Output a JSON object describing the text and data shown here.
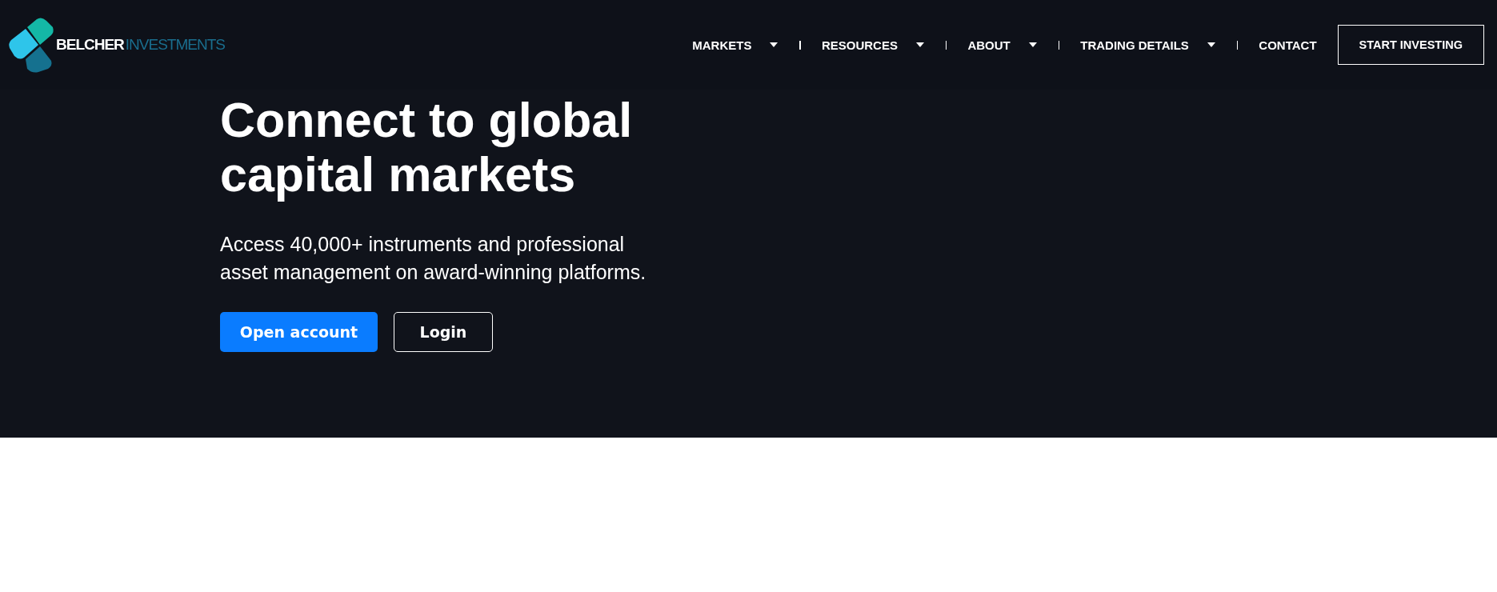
{
  "logo": {
    "name": "BELCHER",
    "suffix": "INVESTMENTS"
  },
  "nav": [
    {
      "label": "MARKETS",
      "dropdown": true
    },
    {
      "label": "RESOURCES",
      "dropdown": true
    },
    {
      "label": "ABOUT",
      "dropdown": true
    },
    {
      "label": "TRADING DETAILS",
      "dropdown": true
    },
    {
      "label": "CONTACT",
      "dropdown": false
    }
  ],
  "cta": "START INVESTING",
  "hero": {
    "title": "Connect to global capital markets",
    "subtitle": "Access 40,000+ instruments and professional asset management on award-winning platforms.",
    "buttons": [
      {
        "label": "Open account",
        "kind": "primary"
      },
      {
        "label": "Login",
        "kind": "outline"
      }
    ]
  }
}
